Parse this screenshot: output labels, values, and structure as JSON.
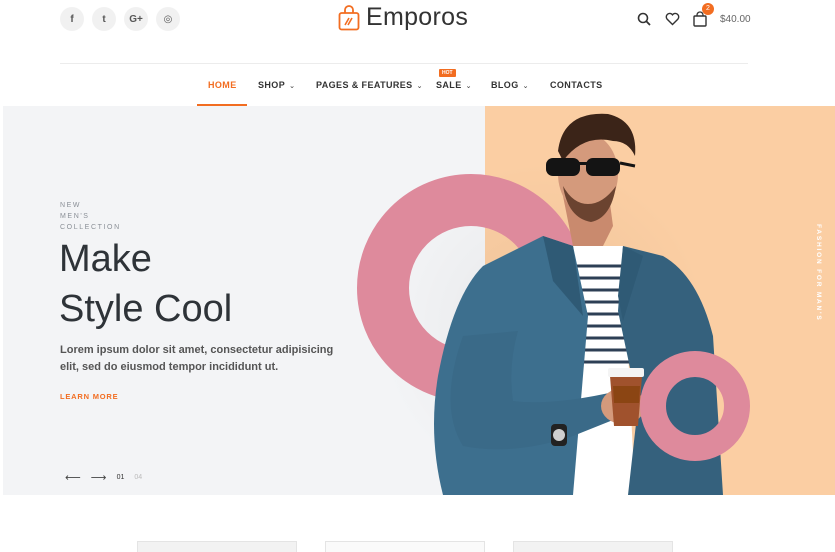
{
  "header": {
    "social": [
      {
        "icon": "facebook-icon",
        "glyph": "f"
      },
      {
        "icon": "twitter-icon",
        "glyph": "t"
      },
      {
        "icon": "google-plus-icon",
        "glyph": "G+"
      },
      {
        "icon": "instagram-icon",
        "glyph": "◎"
      }
    ],
    "brand": "Emporos",
    "cart": {
      "count": "2",
      "total": "$40.00"
    }
  },
  "nav": {
    "items": [
      {
        "label": "HOME",
        "active": true
      },
      {
        "label": "SHOP",
        "caret": true
      },
      {
        "label": "PAGES & FEATURES",
        "caret": true
      },
      {
        "label": "SALE",
        "caret": true,
        "badge": "HOT"
      },
      {
        "label": "BLOG",
        "caret": true
      },
      {
        "label": "CONTACTS"
      }
    ]
  },
  "hero": {
    "kicker": [
      "NEW",
      "MEN'S",
      "COLLECTION"
    ],
    "headline": [
      "Make",
      "Style Cool"
    ],
    "description": "Lorem ipsum dolor sit amet, consectetur adipisicing elit, sed do eiusmod tempor incididunt ut.",
    "cta": "LEARN MORE",
    "slider": {
      "prev": "⟵",
      "next": "⟶",
      "current": "01",
      "total": "04"
    },
    "vertical_text": "FASHION FOR MAN'S"
  },
  "colors": {
    "accent": "#f26d21",
    "hero_bg": "#f3f4f6",
    "peach": "#fbcea3",
    "ring": "#de8a9c",
    "jacket": "#3d6f8e"
  }
}
